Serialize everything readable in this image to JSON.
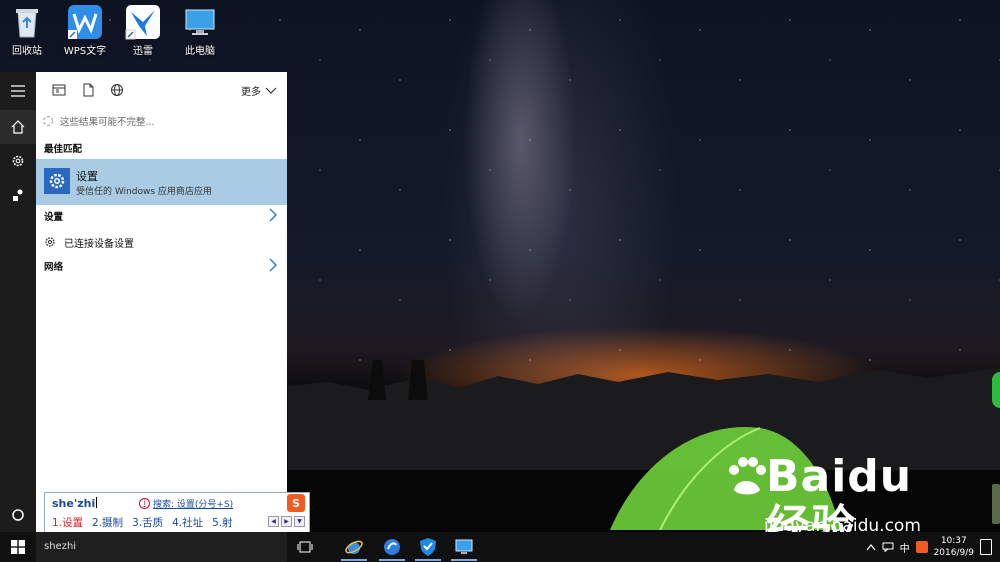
{
  "desktop": {
    "icons": [
      {
        "label": "回收站",
        "icon": "recycle-bin-icon"
      },
      {
        "label": "WPS文字",
        "icon": "wps-writer-icon"
      },
      {
        "label": "迅雷",
        "icon": "xunlei-icon"
      },
      {
        "label": "此电脑",
        "icon": "this-pc-icon"
      }
    ]
  },
  "start_rail": {
    "items": [
      {
        "name": "menu",
        "icon": "hamburger-icon"
      },
      {
        "name": "home",
        "icon": "home-icon"
      },
      {
        "name": "settings",
        "icon": "gear-icon"
      },
      {
        "name": "feedback",
        "icon": "feedback-icon"
      },
      {
        "name": "cortana",
        "icon": "cortana-circle-icon"
      }
    ]
  },
  "search_panel": {
    "toolbar": {
      "filters": [
        "apps-icon",
        "documents-icon",
        "web-icon"
      ],
      "more_label": "更多"
    },
    "notice": "这些结果可能不完整...",
    "best_match_heading": "最佳匹配",
    "best_match": {
      "title": "设置",
      "subtitle": "受信任的 Windows 应用商店应用",
      "icon": "gear-icon"
    },
    "group_settings": "设置",
    "result_item": "已连接设备设置",
    "group_network": "网络"
  },
  "ime": {
    "input": "she'zhi",
    "hint": "搜索: 设置(分号+S)",
    "candidates": [
      "1.设置",
      "2.摄制",
      "3.舌质",
      "4.社址",
      "5.射"
    ],
    "logo": "S"
  },
  "taskbar": {
    "search_text": "shezhi",
    "apps": [
      "task-view-icon",
      "ie-icon",
      "sogou-browser-icon",
      "shield-icon",
      "monitor-icon"
    ],
    "tray": {
      "ime_lang": "中",
      "time": "10:37",
      "date": "2016/9/9"
    }
  },
  "watermark": {
    "brand": "Baidu经验",
    "url": "jingyan.baidu.com"
  }
}
